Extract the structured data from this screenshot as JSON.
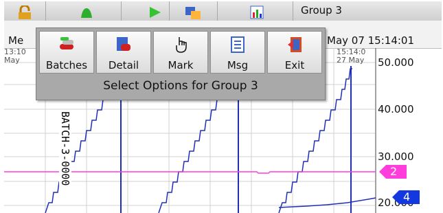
{
  "toolbar": {
    "menu_label": "Me",
    "group_title": "Group 3"
  },
  "status": {
    "datetime": "May 07  15:14:01"
  },
  "chart": {
    "left_time": "13:10",
    "left_date": "May",
    "right_time": "15:14:0",
    "right_date": "27 May",
    "ticks": [
      "50.000",
      "40.000",
      "30.000",
      "20.000"
    ],
    "batch_label": "BATCH-3-0000",
    "marker_2": "2",
    "marker_4": "4"
  },
  "popup": {
    "buttons": {
      "batches": "Batches",
      "detail": "Detail",
      "mark": "Mark",
      "msg": "Msg",
      "exit": "Exit"
    },
    "caption": "Select Options for Group 3"
  },
  "colors": {
    "trace_blue": "#1f2fb5",
    "trace_magenta": "#ff3ddc",
    "marker_blue": "#1438e0",
    "grid": "#cfcfcf"
  }
}
